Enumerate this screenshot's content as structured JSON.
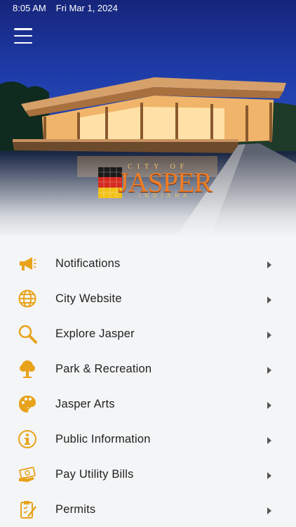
{
  "status_bar": {
    "time": "8:05 AM",
    "date": "Fri Mar 1, 2024"
  },
  "hero": {
    "logo": {
      "top_text": "CITY OF",
      "name": "JASPER",
      "bottom_text": "INDIANA"
    }
  },
  "menu": {
    "icon_color": "#e8a31a",
    "items": [
      {
        "label": "Notifications",
        "icon": "megaphone-icon"
      },
      {
        "label": "City Website",
        "icon": "globe-icon"
      },
      {
        "label": "Explore Jasper",
        "icon": "magnifier-icon"
      },
      {
        "label": "Park & Recreation",
        "icon": "tree-icon"
      },
      {
        "label": "Jasper Arts",
        "icon": "palette-icon"
      },
      {
        "label": "Public Information",
        "icon": "info-icon"
      },
      {
        "label": "Pay Utility Bills",
        "icon": "money-icon"
      },
      {
        "label": "Permits",
        "icon": "clipboard-icon"
      }
    ]
  }
}
